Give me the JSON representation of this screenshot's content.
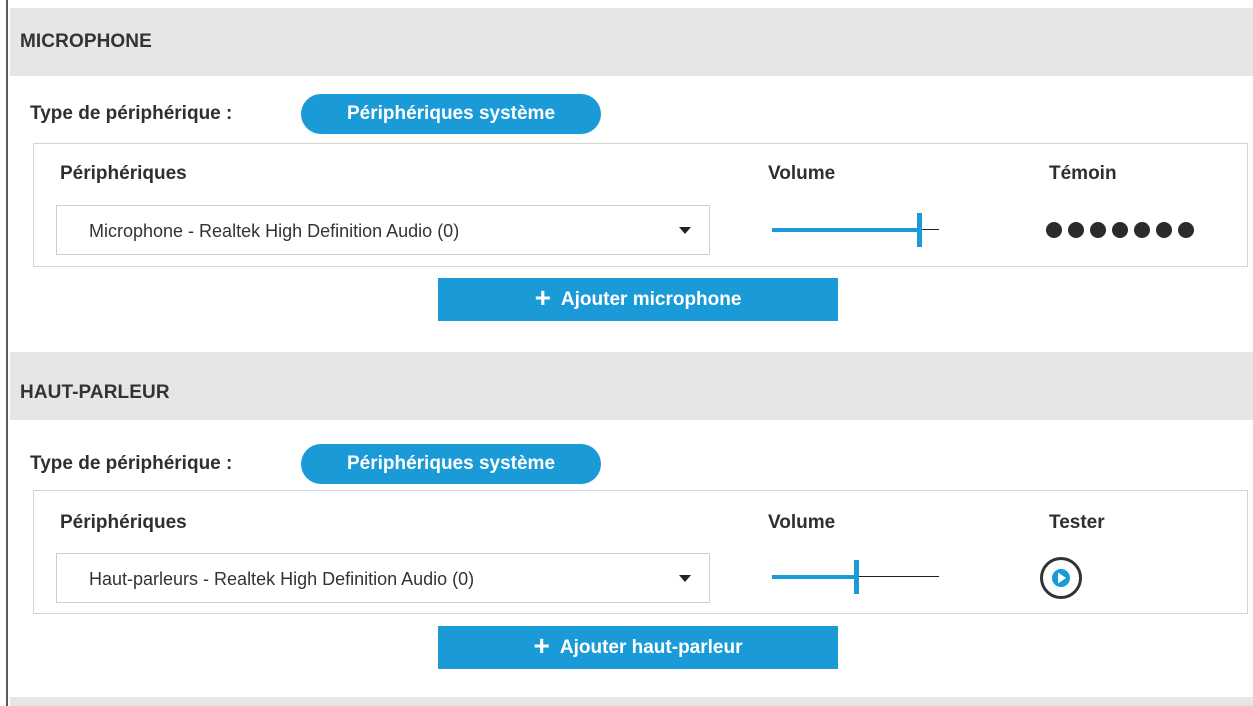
{
  "microphone": {
    "header": "MICROPHONE",
    "device_type_label": "Type de périphérique :",
    "device_type_value": "Périphériques système",
    "col_devices": "Périphériques",
    "col_volume": "Volume",
    "col_indicator": "Témoin",
    "selected_device": "Microphone - Realtek High Definition Audio (0)",
    "volume_level": 0.88,
    "indicator_dots": 7,
    "add_button": "Ajouter microphone"
  },
  "speaker": {
    "header": "HAUT-PARLEUR",
    "device_type_label": "Type de périphérique :",
    "device_type_value": "Périphériques système",
    "col_devices": "Périphériques",
    "col_volume": "Volume",
    "col_test": "Tester",
    "selected_device": "Haut-parleurs - Realtek High Definition Audio (0)",
    "volume_level": 0.5,
    "add_button": "Ajouter haut-parleur"
  },
  "colors": {
    "accent": "#1a9bd7",
    "header_bg": "#e6e6e6",
    "text": "#2f2f2f"
  },
  "icons": {
    "dropdown": "chevron-down-icon",
    "add": "plus-icon",
    "play": "play-icon",
    "level_dot": "level-dot"
  }
}
